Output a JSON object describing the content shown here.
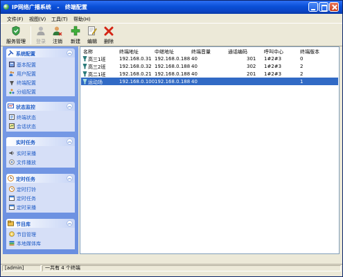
{
  "window": {
    "title": "IP网络广播系统   -   终端配置",
    "colors": {
      "title_bar": "#0a4fd6",
      "selected_row": "#316ac5",
      "sidebar_bg": "#6a8fe0",
      "panel_title": "#215dc6"
    }
  },
  "menu": [
    "文件(F)",
    "视图(V)",
    "工具(T)",
    "帮助(H)"
  ],
  "toolbar": {
    "service": {
      "label": "服务管理",
      "icon": "service-shield-icon"
    },
    "login": {
      "label": "登录",
      "icon": "user-icon",
      "disabled": true
    },
    "logout": {
      "label": "注销",
      "icon": "user-logout-icon"
    },
    "new": {
      "label": "新建",
      "icon": "plus-icon"
    },
    "edit": {
      "label": "编辑",
      "icon": "edit-icon"
    },
    "delete": {
      "label": "删除",
      "icon": "delete-x-icon"
    }
  },
  "sidebar": {
    "system": {
      "title": "系统配置",
      "items": [
        "基本配置",
        "用户配置",
        "终端配置",
        "分组配置"
      ]
    },
    "status": {
      "title": "状态监控",
      "items": [
        "终端状态",
        "会话状态"
      ]
    },
    "realtime": {
      "title": "实时任务",
      "items": [
        "实时采播",
        "文件播放"
      ]
    },
    "scheduled": {
      "title": "定时任务",
      "items": [
        "定时打铃",
        "定时任务",
        "定时采播"
      ]
    },
    "library": {
      "title": "节目库",
      "items": [
        "节目管理",
        "本地媒体库"
      ]
    }
  },
  "table": {
    "columns": [
      "名称",
      "终端地址",
      "中继地址",
      "终端音量",
      "通话编码",
      "呼叫中心",
      "终端版本"
    ],
    "rows": [
      [
        "高三1班",
        "192.168.0.31",
        "192.168.0.188",
        "40",
        "301",
        "1#2#3",
        "0"
      ],
      [
        "高三2班",
        "192.168.0.32",
        "192.168.0.188",
        "40",
        "302",
        "1#2#3",
        "2"
      ],
      [
        "高二1班",
        "192.168.0.21",
        "192.168.0.188",
        "40",
        "201",
        "1#2#3",
        "2"
      ],
      [
        "运动场",
        "192.168.0.100",
        "192.168.0.188",
        "40",
        "",
        "",
        "1"
      ]
    ],
    "selected_row": 3
  },
  "status": {
    "user": "[admin]",
    "count": "一共有 4 个终端"
  }
}
